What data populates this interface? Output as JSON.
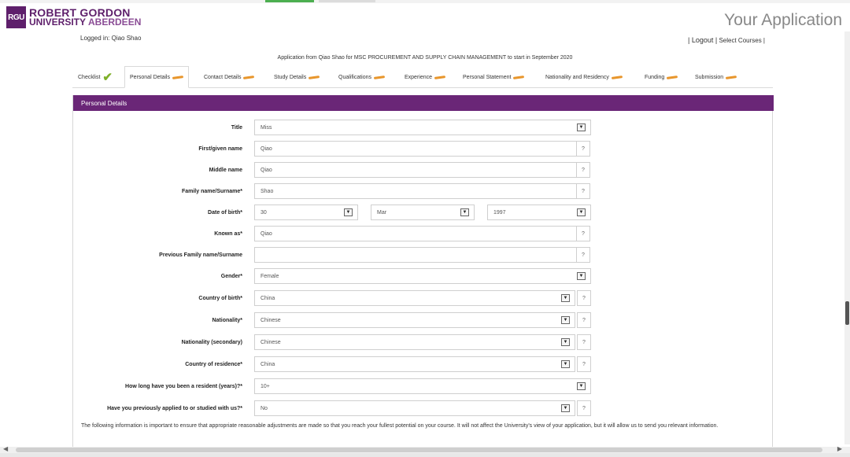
{
  "brand": {
    "logo_mark": "RGU",
    "line1": "ROBERT GORDON",
    "line2a": "UNIVERSITY",
    "line2b": "ABERDEEN"
  },
  "page_title": "Your Application",
  "user": {
    "logged_in": "Logged in: Qiao Shao"
  },
  "links": {
    "logout": "| Logout |",
    "select_courses": "Select Courses |"
  },
  "application_from": "Application from Qiao Shao for MSC PROCUREMENT AND SUPPLY CHAIN MANAGEMENT to start in September 2020",
  "tabs": [
    {
      "label": "Checklist",
      "status": "complete"
    },
    {
      "label": "Personal Details",
      "status": "active"
    },
    {
      "label": "Contact Details",
      "status": "incomplete"
    },
    {
      "label": "Study Details",
      "status": "incomplete"
    },
    {
      "label": "Qualifications",
      "status": "incomplete"
    },
    {
      "label": "Experience",
      "status": "incomplete"
    },
    {
      "label": "Personal Statement",
      "status": "incomplete"
    },
    {
      "label": "Nationality and Residency",
      "status": "incomplete"
    },
    {
      "label": "Funding",
      "status": "incomplete"
    },
    {
      "label": "Submission",
      "status": "incomplete"
    }
  ],
  "icons": {
    "complete": "check-icon",
    "incomplete": "pencil-icon",
    "dropdown": "chevron-down-icon",
    "help": "question-icon"
  },
  "panel": {
    "title": "Personal Details"
  },
  "form": {
    "title": {
      "label": "Title",
      "value": "Miss"
    },
    "first_name": {
      "label": "First/given name",
      "value": "Qiao"
    },
    "middle_name": {
      "label": "Middle name",
      "value": "Qiao"
    },
    "family_name": {
      "label": "Family name/Surname*",
      "value": "Shao"
    },
    "dob": {
      "label": "Date of birth*",
      "day": "30",
      "month": "Mar",
      "year": "1997"
    },
    "known_as": {
      "label": "Known as*",
      "value": "Qiao"
    },
    "previous_family_name": {
      "label": "Previous Family name/Surname",
      "value": ""
    },
    "gender": {
      "label": "Gender*",
      "value": "Female"
    },
    "country_of_birth": {
      "label": "Country of birth*",
      "value": "China"
    },
    "nationality": {
      "label": "Nationality*",
      "value": "Chinese"
    },
    "nationality_secondary": {
      "label": "Nationality (secondary)",
      "value": "Chinese"
    },
    "country_of_residence": {
      "label": "Country of residence*",
      "value": "China"
    },
    "resident_years": {
      "label": "How long have you been a resident (years)?*",
      "value": "10+"
    },
    "previously_applied": {
      "label": "Have you previously applied to or studied with us?*",
      "value": "No"
    }
  },
  "help_glyph": "?",
  "dropdown_glyph": "▼",
  "info_text": "The following information is important to ensure that appropriate reasonable adjustments are made so that you reach your fullest potential on your course. It will not affect the University's view of your application, but it will allow us to send you relevant information.",
  "colors": {
    "brand": "#5e1f6b",
    "panel_header": "#6a2677",
    "pencil": "#e8962c",
    "check": "#7fb02a"
  }
}
